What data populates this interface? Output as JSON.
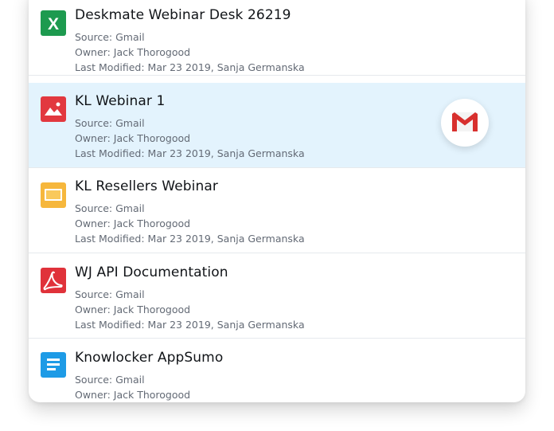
{
  "files": [
    {
      "title": "Deskmate Webinar Desk 26219",
      "source": "Source: Gmail",
      "owner": "Owner: Jack Thorogood",
      "modified": "Last Modified: Mar 23 2019, Sanja Germanska",
      "icon": "excel-icon",
      "icon_color": "#1d9a4f",
      "icon_letter": "X"
    },
    {
      "title": "KL Webinar 1",
      "source": "Source: Gmail",
      "owner": "Owner: Jack Thorogood",
      "modified": "Last Modified: Mar 23 2019, Sanja Germanska",
      "icon": "image-icon",
      "icon_color": "#e2383f",
      "selected": true,
      "badge_icon": "gmail-icon"
    },
    {
      "title": "KL Resellers Webinar",
      "source": "Source: Gmail",
      "owner": "Owner: Jack Thorogood",
      "modified": "Last Modified: Mar 23 2019, Sanja Germanska",
      "icon": "slides-icon",
      "icon_color": "#f6b73c"
    },
    {
      "title": "WJ API Documentation",
      "source": "Source: Gmail",
      "owner": "Owner: Jack Thorogood",
      "modified": "Last Modified: Mar 23 2019, Sanja Germanska",
      "icon": "pdf-icon",
      "icon_color": "#e0323a"
    },
    {
      "title": "Knowlocker AppSumo",
      "source": "Source: Gmail",
      "owner": "Owner: Jack Thorogood",
      "icon": "document-icon",
      "icon_color": "#1e9be6"
    }
  ],
  "colors": {
    "selected_bg": "#e3f3fd",
    "gmail_red": "#d8302e"
  }
}
